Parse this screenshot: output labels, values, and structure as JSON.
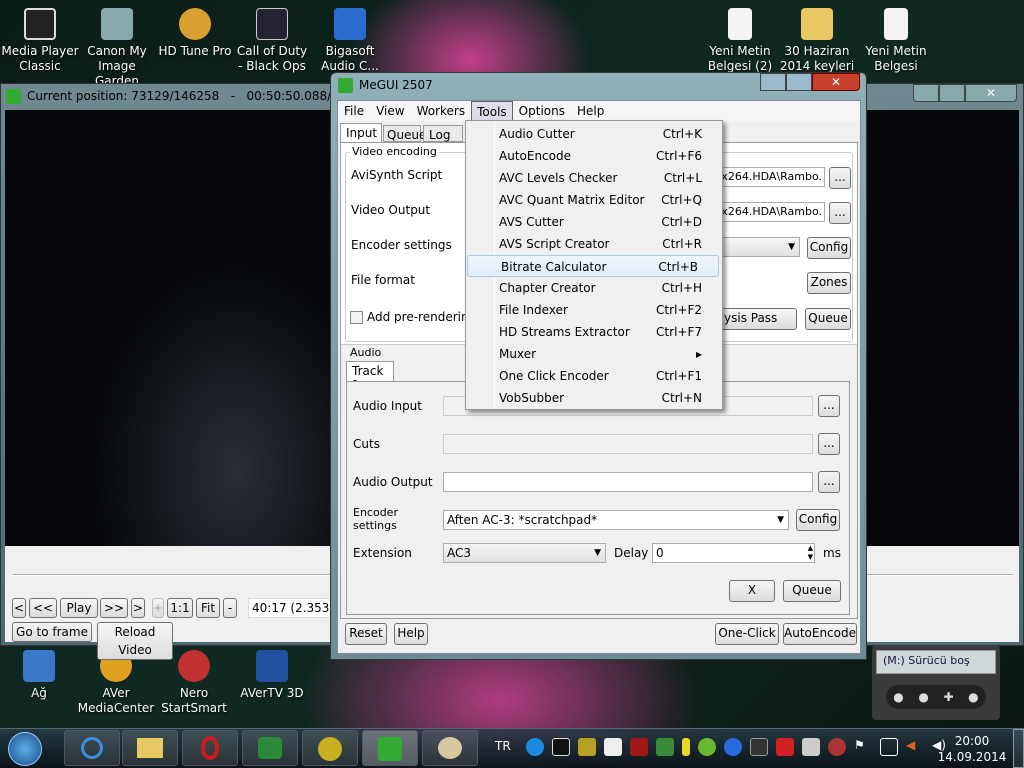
{
  "desktop": {
    "top_icons": [
      "Media Player Classic",
      "Canon My Image Garden",
      "HD Tune Pro",
      "Call of Duty - Black Ops",
      "Bigasoft Audio C..."
    ],
    "right_icons": [
      "Yeni Metin Belgesi (2)",
      "30 Haziran 2014 keyleri",
      "Yeni Metin Belgesi"
    ],
    "bottom_icons": [
      "Ağ",
      "AVer MediaCenter",
      "Nero StartSmart",
      "AVerTV 3D"
    ]
  },
  "player": {
    "title": "Current position: 73129/146258   -   00:50:50.088/01:41:4",
    "buttons": [
      "<",
      "<<",
      "Play",
      ">>",
      ">",
      "+",
      "1:1",
      "Fit",
      "-"
    ],
    "ratio": "40:17 (2.353)",
    "goto": "Go to frame",
    "reload": "Reload Video"
  },
  "megui": {
    "title": "MeGUI 2507",
    "menu": [
      "File",
      "View",
      "Workers",
      "Tools",
      "Options",
      "Help"
    ],
    "tabs": [
      "Input",
      "Queue",
      "Log"
    ],
    "video": {
      "group": "Video encoding",
      "avisynth": "AviSynth Script",
      "avisynth_value": "y.x264.HDA\\Rambo.",
      "output": "Video Output",
      "output_value": "y.x264.HDA\\Rambo.",
      "encoder": "Encoder settings",
      "format": "File format",
      "prerender": "Add pre-rendering jo",
      "browse": "...",
      "config": "Config",
      "zones": "Zones",
      "analysis": "ysis Pass",
      "queue": "Queue"
    },
    "audio": {
      "group": "Audio",
      "track": "Track 1",
      "input": "Audio Input",
      "cuts": "Cuts",
      "output": "Audio Output",
      "encoder": "Encoder settings",
      "encoder_value": "Aften AC-3: *scratchpad*",
      "config": "Config",
      "extension": "Extension",
      "extension_value": "AC3",
      "delay": "Delay",
      "delay_value": "0",
      "ms": "ms",
      "x": "X",
      "queue": "Queue",
      "browse": "..."
    },
    "bottom": {
      "reset": "Reset",
      "help": "Help",
      "oneclick": "One-Click",
      "autoencode": "AutoEncode"
    }
  },
  "tools_menu": [
    {
      "label": "Audio Cutter",
      "key": "Ctrl+K"
    },
    {
      "label": "AutoEncode",
      "key": "Ctrl+F6"
    },
    {
      "label": "AVC Levels Checker",
      "key": "Ctrl+L"
    },
    {
      "label": "AVC Quant Matrix Editor",
      "key": "Ctrl+Q"
    },
    {
      "label": "AVS Cutter",
      "key": "Ctrl+D"
    },
    {
      "label": "AVS Script Creator",
      "key": "Ctrl+R"
    },
    {
      "label": "Bitrate Calculator",
      "key": "Ctrl+B"
    },
    {
      "label": "Chapter Creator",
      "key": "Ctrl+H"
    },
    {
      "label": "File Indexer",
      "key": "Ctrl+F2"
    },
    {
      "label": "HD Streams Extractor",
      "key": "Ctrl+F7"
    },
    {
      "label": "Muxer",
      "key": "▸"
    },
    {
      "label": "One Click Encoder",
      "key": "Ctrl+F1"
    },
    {
      "label": "VobSubber",
      "key": "Ctrl+N"
    }
  ],
  "gadget": {
    "text": "(M:) Sürücü boş"
  },
  "taskbar": {
    "lang": "TR",
    "time": "20:00",
    "date": "14.09.2014"
  }
}
